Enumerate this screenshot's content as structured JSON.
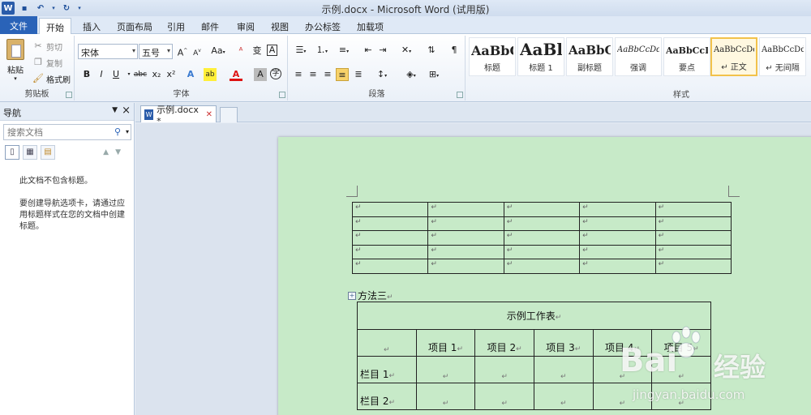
{
  "window": {
    "title": "示例.docx - Microsoft Word (试用版)"
  },
  "quick_access": [
    "save-icon",
    "undo-icon",
    "redo-icon"
  ],
  "ribbon_tabs": [
    {
      "label": "文件"
    },
    {
      "label": "开始"
    },
    {
      "label": "插入"
    },
    {
      "label": "页面布局"
    },
    {
      "label": "引用"
    },
    {
      "label": "邮件"
    },
    {
      "label": "审阅"
    },
    {
      "label": "视图"
    },
    {
      "label": "办公标签"
    },
    {
      "label": "加载项"
    }
  ],
  "clipboard": {
    "group_label": "剪贴板",
    "paste": "粘贴",
    "cut": "剪切",
    "copy": "复制",
    "format_painter": "格式刷"
  },
  "font": {
    "group_label": "字体",
    "font_name": "宋体",
    "font_size": "五号",
    "aa_label": "Aa",
    "buttons": [
      "B",
      "I",
      "U",
      "abc",
      "x₂",
      "x²"
    ],
    "char_border": "A",
    "wen": "文",
    "phonetic": "变",
    "circle": "字",
    "highlight": "ab",
    "color_a": "A"
  },
  "paragraph": {
    "group_label": "段落"
  },
  "styles": {
    "group_label": "样式",
    "items": [
      {
        "sample": "AaBbC",
        "name": "标题"
      },
      {
        "sample": "AaBl",
        "name": "标题 1"
      },
      {
        "sample": "AaBbC",
        "name": "副标题"
      },
      {
        "sample": "AaBbCcDd",
        "name": "强调"
      },
      {
        "sample": "AaBbCcD",
        "name": "要点"
      },
      {
        "sample": "AaBbCcDd",
        "name": "↵ 正文"
      },
      {
        "sample": "AaBbCcDd",
        "name": "↵ 无间隔"
      }
    ]
  },
  "nav": {
    "title": "导航",
    "search_placeholder": "搜索文档",
    "message_1": "此文档不包含标题。",
    "message_2": "要创建导航选项卡，请通过应用标题样式在您的文档中创建标题。"
  },
  "doc_tab": {
    "label": "示例.docx *"
  },
  "document": {
    "paragraph_mark": "↵",
    "method_label": "方法三",
    "table2_caption": "示例工作表",
    "table2_headers": [
      "",
      "项目 1",
      "项目 2",
      "项目 3",
      "项目 4",
      "项目 5"
    ],
    "table2_rows": [
      [
        "栏目 1",
        "",
        "",
        "",
        "",
        ""
      ],
      [
        "栏目 2",
        "",
        "",
        "",
        "",
        ""
      ]
    ]
  },
  "watermark": {
    "logo": "Bai",
    "logo_cn": "经验",
    "url": "jingyan.baidu.com"
  }
}
